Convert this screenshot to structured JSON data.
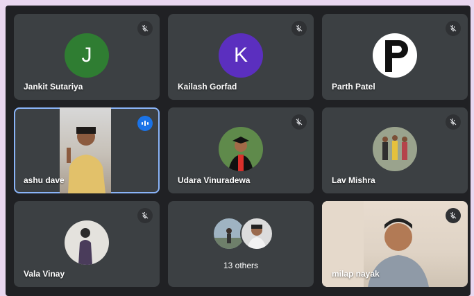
{
  "participants": [
    {
      "name": "Jankit Sutariya",
      "initial": "J",
      "avatar_color": "#2f7d32"
    },
    {
      "name": "Kailash Gorfad",
      "initial": "K",
      "avatar_color": "#5b2fbf"
    },
    {
      "name": "Parth Patel",
      "initial": "P",
      "avatar_color": "#111111"
    },
    {
      "name": "ashu dave"
    },
    {
      "name": "Udara Vinuradewa"
    },
    {
      "name": "Lav Mishra"
    },
    {
      "name": "Vala Vinay"
    },
    {
      "others_label": "13 others"
    },
    {
      "name": "milap nayak"
    }
  ],
  "icons": {
    "muted": "mic-off-icon",
    "speaking": "speaking-indicator-icon"
  },
  "accent": "#8ab4f8",
  "speaking_color": "#1a73e8"
}
